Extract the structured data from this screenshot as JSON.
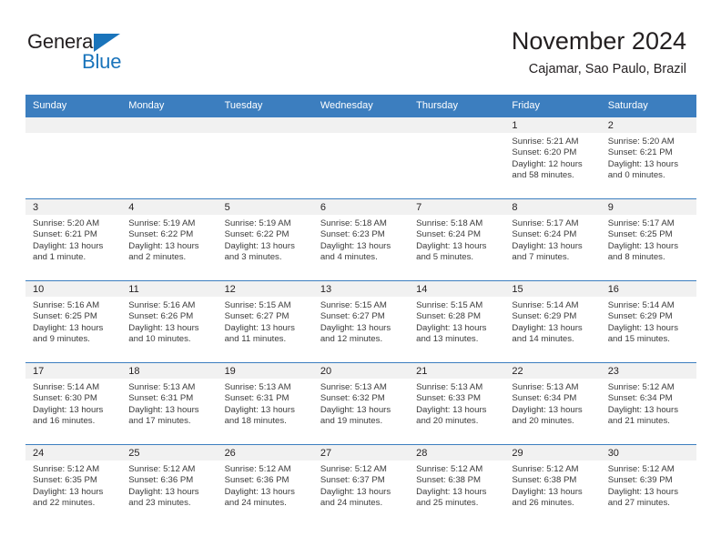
{
  "brand": {
    "name_part1": "General",
    "name_part2": "Blue"
  },
  "header": {
    "title": "November 2024",
    "subtitle": "Cajamar, Sao Paulo, Brazil"
  },
  "colors": {
    "header_blue": "#3c7ebf",
    "brand_blue": "#1a74bb",
    "daynum_bg": "#f1f1f1",
    "text": "#231f20"
  },
  "weekday_headers": [
    "Sunday",
    "Monday",
    "Tuesday",
    "Wednesday",
    "Thursday",
    "Friday",
    "Saturday"
  ],
  "weeks": [
    [
      {
        "day": "",
        "sunrise": "",
        "sunset": "",
        "daylight": ""
      },
      {
        "day": "",
        "sunrise": "",
        "sunset": "",
        "daylight": ""
      },
      {
        "day": "",
        "sunrise": "",
        "sunset": "",
        "daylight": ""
      },
      {
        "day": "",
        "sunrise": "",
        "sunset": "",
        "daylight": ""
      },
      {
        "day": "",
        "sunrise": "",
        "sunset": "",
        "daylight": ""
      },
      {
        "day": "1",
        "sunrise": "Sunrise: 5:21 AM",
        "sunset": "Sunset: 6:20 PM",
        "daylight": "Daylight: 12 hours and 58 minutes."
      },
      {
        "day": "2",
        "sunrise": "Sunrise: 5:20 AM",
        "sunset": "Sunset: 6:21 PM",
        "daylight": "Daylight: 13 hours and 0 minutes."
      }
    ],
    [
      {
        "day": "3",
        "sunrise": "Sunrise: 5:20 AM",
        "sunset": "Sunset: 6:21 PM",
        "daylight": "Daylight: 13 hours and 1 minute."
      },
      {
        "day": "4",
        "sunrise": "Sunrise: 5:19 AM",
        "sunset": "Sunset: 6:22 PM",
        "daylight": "Daylight: 13 hours and 2 minutes."
      },
      {
        "day": "5",
        "sunrise": "Sunrise: 5:19 AM",
        "sunset": "Sunset: 6:22 PM",
        "daylight": "Daylight: 13 hours and 3 minutes."
      },
      {
        "day": "6",
        "sunrise": "Sunrise: 5:18 AM",
        "sunset": "Sunset: 6:23 PM",
        "daylight": "Daylight: 13 hours and 4 minutes."
      },
      {
        "day": "7",
        "sunrise": "Sunrise: 5:18 AM",
        "sunset": "Sunset: 6:24 PM",
        "daylight": "Daylight: 13 hours and 5 minutes."
      },
      {
        "day": "8",
        "sunrise": "Sunrise: 5:17 AM",
        "sunset": "Sunset: 6:24 PM",
        "daylight": "Daylight: 13 hours and 7 minutes."
      },
      {
        "day": "9",
        "sunrise": "Sunrise: 5:17 AM",
        "sunset": "Sunset: 6:25 PM",
        "daylight": "Daylight: 13 hours and 8 minutes."
      }
    ],
    [
      {
        "day": "10",
        "sunrise": "Sunrise: 5:16 AM",
        "sunset": "Sunset: 6:25 PM",
        "daylight": "Daylight: 13 hours and 9 minutes."
      },
      {
        "day": "11",
        "sunrise": "Sunrise: 5:16 AM",
        "sunset": "Sunset: 6:26 PM",
        "daylight": "Daylight: 13 hours and 10 minutes."
      },
      {
        "day": "12",
        "sunrise": "Sunrise: 5:15 AM",
        "sunset": "Sunset: 6:27 PM",
        "daylight": "Daylight: 13 hours and 11 minutes."
      },
      {
        "day": "13",
        "sunrise": "Sunrise: 5:15 AM",
        "sunset": "Sunset: 6:27 PM",
        "daylight": "Daylight: 13 hours and 12 minutes."
      },
      {
        "day": "14",
        "sunrise": "Sunrise: 5:15 AM",
        "sunset": "Sunset: 6:28 PM",
        "daylight": "Daylight: 13 hours and 13 minutes."
      },
      {
        "day": "15",
        "sunrise": "Sunrise: 5:14 AM",
        "sunset": "Sunset: 6:29 PM",
        "daylight": "Daylight: 13 hours and 14 minutes."
      },
      {
        "day": "16",
        "sunrise": "Sunrise: 5:14 AM",
        "sunset": "Sunset: 6:29 PM",
        "daylight": "Daylight: 13 hours and 15 minutes."
      }
    ],
    [
      {
        "day": "17",
        "sunrise": "Sunrise: 5:14 AM",
        "sunset": "Sunset: 6:30 PM",
        "daylight": "Daylight: 13 hours and 16 minutes."
      },
      {
        "day": "18",
        "sunrise": "Sunrise: 5:13 AM",
        "sunset": "Sunset: 6:31 PM",
        "daylight": "Daylight: 13 hours and 17 minutes."
      },
      {
        "day": "19",
        "sunrise": "Sunrise: 5:13 AM",
        "sunset": "Sunset: 6:31 PM",
        "daylight": "Daylight: 13 hours and 18 minutes."
      },
      {
        "day": "20",
        "sunrise": "Sunrise: 5:13 AM",
        "sunset": "Sunset: 6:32 PM",
        "daylight": "Daylight: 13 hours and 19 minutes."
      },
      {
        "day": "21",
        "sunrise": "Sunrise: 5:13 AM",
        "sunset": "Sunset: 6:33 PM",
        "daylight": "Daylight: 13 hours and 20 minutes."
      },
      {
        "day": "22",
        "sunrise": "Sunrise: 5:13 AM",
        "sunset": "Sunset: 6:34 PM",
        "daylight": "Daylight: 13 hours and 20 minutes."
      },
      {
        "day": "23",
        "sunrise": "Sunrise: 5:12 AM",
        "sunset": "Sunset: 6:34 PM",
        "daylight": "Daylight: 13 hours and 21 minutes."
      }
    ],
    [
      {
        "day": "24",
        "sunrise": "Sunrise: 5:12 AM",
        "sunset": "Sunset: 6:35 PM",
        "daylight": "Daylight: 13 hours and 22 minutes."
      },
      {
        "day": "25",
        "sunrise": "Sunrise: 5:12 AM",
        "sunset": "Sunset: 6:36 PM",
        "daylight": "Daylight: 13 hours and 23 minutes."
      },
      {
        "day": "26",
        "sunrise": "Sunrise: 5:12 AM",
        "sunset": "Sunset: 6:36 PM",
        "daylight": "Daylight: 13 hours and 24 minutes."
      },
      {
        "day": "27",
        "sunrise": "Sunrise: 5:12 AM",
        "sunset": "Sunset: 6:37 PM",
        "daylight": "Daylight: 13 hours and 24 minutes."
      },
      {
        "day": "28",
        "sunrise": "Sunrise: 5:12 AM",
        "sunset": "Sunset: 6:38 PM",
        "daylight": "Daylight: 13 hours and 25 minutes."
      },
      {
        "day": "29",
        "sunrise": "Sunrise: 5:12 AM",
        "sunset": "Sunset: 6:38 PM",
        "daylight": "Daylight: 13 hours and 26 minutes."
      },
      {
        "day": "30",
        "sunrise": "Sunrise: 5:12 AM",
        "sunset": "Sunset: 6:39 PM",
        "daylight": "Daylight: 13 hours and 27 minutes."
      }
    ]
  ]
}
